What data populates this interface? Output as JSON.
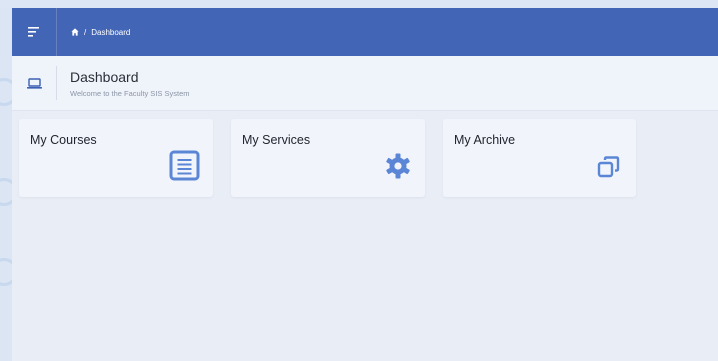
{
  "header": {
    "breadcrumb_separator": "/",
    "breadcrumb_current": "Dashboard"
  },
  "page": {
    "title": "Dashboard",
    "subtitle": "Welcome to the Faculty SIS System"
  },
  "cards": [
    {
      "label": "My Courses",
      "icon": "document-list-icon"
    },
    {
      "label": "My Services",
      "icon": "gear-icon"
    },
    {
      "label": "My Archive",
      "icon": "copy-stack-icon"
    }
  ],
  "colors": {
    "header_bg": "#4365b6",
    "accent_icon": "#5b86d6",
    "page_bg": "#e9eef6",
    "card_bg": "#f1f4fb"
  }
}
